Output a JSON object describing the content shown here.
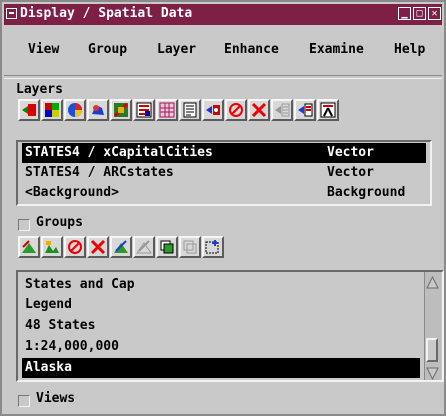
{
  "window": {
    "title": "Display / Spatial Data",
    "controls": {
      "minimize": "minimize-icon",
      "maximize": "maximize-icon",
      "close": "close-icon"
    }
  },
  "menu": [
    "View",
    "Group",
    "Layer",
    "Enhance",
    "Examine",
    "Help"
  ],
  "layers": {
    "label": "Layers",
    "toolbar": [
      "add-layer-icon",
      "add-raster-icon",
      "add-rgb-icon",
      "add-vector-icon",
      "add-geometric-icon",
      "add-cad-icon",
      "add-tin-icon",
      "add-text-icon",
      "add-special-icon",
      "remove-layer-icon",
      "delete-icon",
      "raise-layer-icon",
      "lower-layer-icon",
      "layer-controls-icon"
    ],
    "rows": [
      {
        "name": "STATES4 / xCapitalCities",
        "type": "Vector",
        "selected": true
      },
      {
        "name": "STATES4 / ARCstates",
        "type": "Vector",
        "selected": false
      },
      {
        "name": "<Background>",
        "type": "Background",
        "selected": false
      }
    ]
  },
  "groups": {
    "label": "Groups",
    "toolbar": [
      "new-group-icon",
      "new-layout-icon",
      "remove-group-icon",
      "delete-group-icon",
      "group-settings-icon",
      "group-edit-icon",
      "group-copy-icon",
      "group-stack-icon",
      "group-extents-icon"
    ],
    "rows": [
      {
        "name": "States and Cap",
        "selected": false
      },
      {
        "name": "Legend",
        "selected": false
      },
      {
        "name": "48 States",
        "selected": false
      },
      {
        "name": "1:24,000,000",
        "selected": false
      },
      {
        "name": "Alaska",
        "selected": true
      }
    ]
  },
  "views": {
    "label": "Views"
  }
}
